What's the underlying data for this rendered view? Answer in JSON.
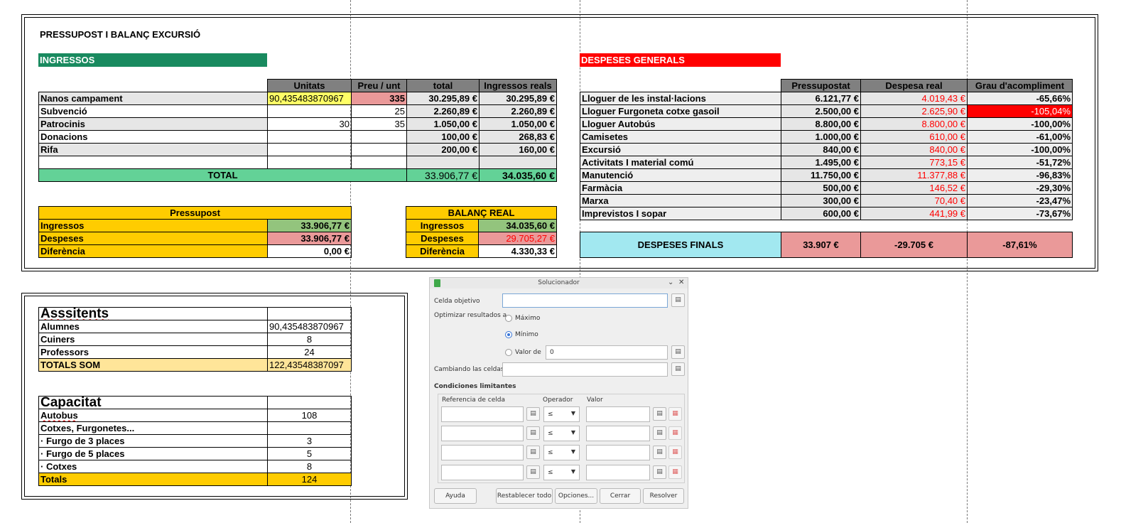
{
  "sheet": {
    "main_title": "PRESSUPOST I BALANÇ EXCURSIÓ",
    "ingressos_header": "INGRESSOS",
    "despeses_header": "DESPESES GENERALS",
    "income": {
      "headers": [
        "Unitats",
        "Preu / unt",
        "total",
        "Ingressos reals"
      ],
      "rows": [
        {
          "label": "Nanos campament",
          "units": "90,435483870967",
          "price": "335",
          "total": "30.295,89 €",
          "real": "30.295,89 €"
        },
        {
          "label": "Subvenció",
          "units": "",
          "price": "25",
          "total": "2.260,89 €",
          "real": "2.260,89 €"
        },
        {
          "label": "Patrocinis",
          "units": "30",
          "price": "35",
          "total": "1.050,00 €",
          "real": "1.050,00 €"
        },
        {
          "label": "Donacions",
          "units": "",
          "price": "",
          "total": "100,00 €",
          "real": "268,83 €"
        },
        {
          "label": "Rifa",
          "units": "",
          "price": "",
          "total": "200,00 €",
          "real": "160,00 €"
        }
      ],
      "total_label": "TOTAL",
      "total_value": "33.906,77 €",
      "total_real": "34.035,60 €"
    },
    "expenses": {
      "headers": [
        "Pressupostat",
        "Despesa real",
        "Grau d'acompliment"
      ],
      "rows": [
        {
          "label": "Lloguer de les instal·lacions",
          "budget": "6.121,77 €",
          "real": "4.019,43 €",
          "grade": "-65,66%"
        },
        {
          "label": "Lloguer Furgoneta cotxe gasoil",
          "budget": "2.500,00 €",
          "real": "2.625,90 €",
          "grade": "-105,04%"
        },
        {
          "label": "Lloguer Autobús",
          "budget": "8.800,00 €",
          "real": "8.800,00 €",
          "grade": "-100,00%"
        },
        {
          "label": "Camisetes",
          "budget": "1.000,00 €",
          "real": "610,00 €",
          "grade": "-61,00%"
        },
        {
          "label": "Excursió",
          "budget": "840,00 €",
          "real": "840,00 €",
          "grade": "-100,00%"
        },
        {
          "label": "Activitats I material comú",
          "budget": "1.495,00 €",
          "real": "773,15 €",
          "grade": "-51,72%"
        },
        {
          "label": "Manutenció",
          "budget": "11.750,00 €",
          "real": "11.377,88 €",
          "grade": "-96,83%"
        },
        {
          "label": "Farmàcia",
          "budget": "500,00 €",
          "real": "146,52 €",
          "grade": "-29,30%"
        },
        {
          "label": "Marxa",
          "budget": "300,00 €",
          "real": "70,40 €",
          "grade": "-23,47%"
        },
        {
          "label": "Imprevistos I sopar",
          "budget": "600,00 €",
          "real": "441,99 €",
          "grade": "-73,67%"
        }
      ],
      "final_label": "DESPESES FINALS",
      "final_budget": "33.907 €",
      "final_real": "-29.705 €",
      "final_grade": "-87,61%"
    },
    "pressupost": {
      "title": "Pressupost",
      "rows": [
        {
          "label": "Ingressos",
          "value": "33.906,77 €"
        },
        {
          "label": "Despeses",
          "value": "33.906,77 €"
        },
        {
          "label": "Diferència",
          "value": "0,00 €"
        }
      ]
    },
    "balanc": {
      "title": "BALANÇ REAL",
      "rows": [
        {
          "label": "Ingressos",
          "value": "34.035,60 €"
        },
        {
          "label": "Despeses",
          "value": "29.705,27 €"
        },
        {
          "label": "Diferència",
          "value": "4.330,33 €"
        }
      ]
    },
    "assistents": {
      "title": "Asssitents",
      "rows": [
        {
          "label": "Alumnes",
          "value": "90,435483870967"
        },
        {
          "label": "Cuiners",
          "value": "8"
        },
        {
          "label": "Professors",
          "value": "24"
        }
      ],
      "total_label": "TOTALS SOM",
      "total_value": "122,43548387097"
    },
    "capacitat": {
      "title": "Capacitat",
      "rows": [
        {
          "label": "Autobus",
          "value": "108"
        },
        {
          "label": "Cotxes, Furgonetes...",
          "value": ""
        },
        {
          "label": "· Furgo de 3 places",
          "value": "3"
        },
        {
          "label": "· Furgo de 5 places",
          "value": "5"
        },
        {
          "label": " · Cotxes",
          "value": "8"
        }
      ],
      "total_label": "Totals",
      "total_value": "124"
    }
  },
  "solver": {
    "title": "Solucionador",
    "target_cell_label": "Celda objetivo",
    "target_cell_value": "",
    "optimize_label": "Optimizar resultados a",
    "opt_max": "Máximo",
    "opt_min": "Mínimo",
    "opt_value": "Valor de",
    "opt_value_input": "0",
    "selected_option": "Mínimo",
    "changing_cells_label": "Cambiando las celdas",
    "changing_cells_value": "",
    "constraints_label": "Condiciones limitantes",
    "col_ref": "Referencia de celda",
    "col_op": "Operador",
    "col_val": "Valor",
    "constraint_ops": [
      "≤",
      "≤",
      "≤",
      "≤"
    ],
    "buttons": {
      "help": "Ayuda",
      "reset": "Restablecer todo",
      "options": "Opciones...",
      "close": "Cerrar",
      "solve": "Resolver"
    }
  },
  "colors": {
    "ingressos": "#198a5f",
    "despeses": "#ff0000",
    "total_green": "#63d297",
    "orange": "#ffcc00",
    "pink": "#ea9999",
    "cyan": "#a2e8f0"
  }
}
